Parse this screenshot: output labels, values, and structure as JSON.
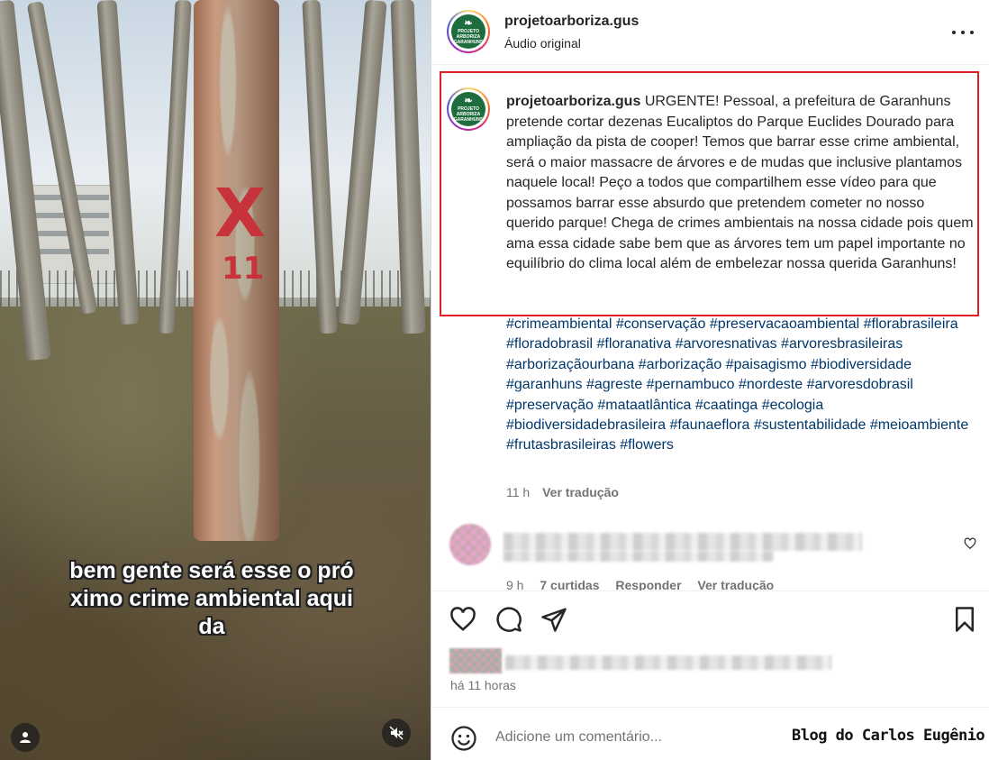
{
  "video": {
    "tree_mark_x": "X",
    "tree_mark_number": "11",
    "caption_lines": [
      "bem gente será esse o pró",
      "ximo crime ambiental aqui",
      "da"
    ],
    "user_icon": "user-icon",
    "mute_icon": "muted-speaker-icon"
  },
  "post": {
    "account": {
      "username": "projetoarboriza.gus",
      "subtitle": "Áudio original",
      "avatar_lines": [
        "PROJETO",
        "ARBORIZA",
        "GARANHUNS"
      ]
    },
    "caption": {
      "username": "projetoarboriza.gus",
      "text": "URGENTE! Pessoal, a prefeitura de Garanhuns pretende cortar dezenas Eucaliptos do Parque Euclides Dourado para ampliação da pista de cooper! Temos que barrar esse crime ambiental, será o maior massacre de árvores e de mudas que inclusive plantamos naquele local! Peço a todos que compartilhem esse vídeo para que possamos barrar esse absurdo que pretendem cometer no nosso querido parque! Chega de crimes ambientais na nossa cidade pois quem ama essa cidade sabe bem que as árvores tem um papel importante no equilíbrio do clima local além de embelezar nossa querida Garanhuns!",
      "hashtags": "#crimeambiental #conservação #preservacaoambiental #florabrasileira #floradobrasil #floranativa #arvoresnativas #arvoresbrasileiras #arborizaçãourbana #arborização #paisagismo #biodiversidade #garanhuns #agreste #pernambuco #nordeste #arvoresdobrasil #preservação #mataatlântica #caatinga #ecologia #biodiversidadebrasileira #faunaeflora #sustentabilidade #meioambiente #frutasbrasileiras #flowers",
      "time": "11 h",
      "translate": "Ver tradução"
    },
    "comment": {
      "time": "9 h",
      "likes": "7 curtidas",
      "reply": "Responder",
      "translate": "Ver tradução"
    },
    "posted_ago": "há 11 horas",
    "add_comment_placeholder": "Adicione um comentário..."
  },
  "watermark": "Blog do Carlos Eugênio",
  "colors": {
    "highlight_border": "#e11e26",
    "hashtag": "#00376b",
    "secondary_text": "#737373",
    "tree_mark": "#c8323b"
  }
}
